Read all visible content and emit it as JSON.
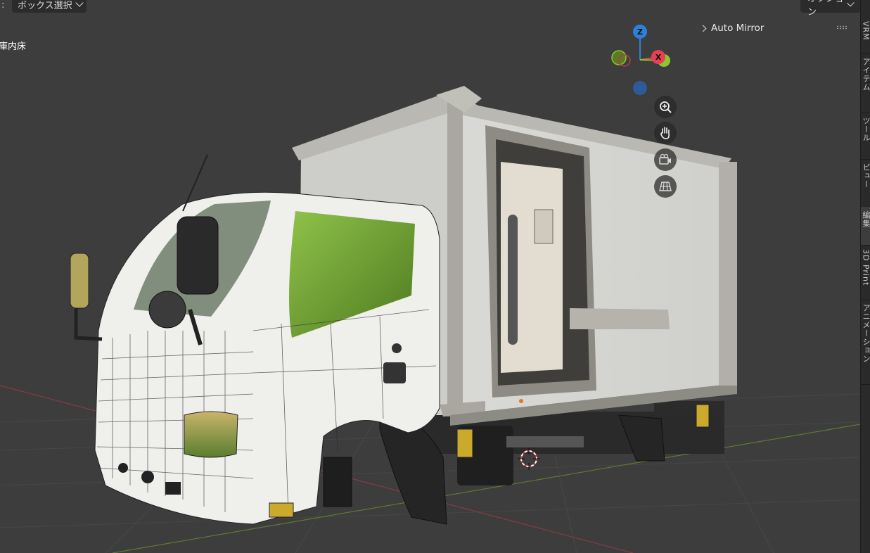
{
  "header": {
    "colon": ":",
    "select_mode": "ボックス選択",
    "options": "オプション"
  },
  "viewport": {
    "object_label": "庫内床",
    "auto_mirror": "Auto Mirror"
  },
  "gizmo": {
    "z": "Z",
    "x": "X"
  },
  "sidebar": {
    "tabs": [
      "VRM",
      "アイテム",
      "ツール",
      "ビュー",
      "編集",
      "3D Print",
      "アニメーション"
    ]
  },
  "colors": {
    "axis_x": "#e83e56",
    "axis_y": "#8bc72f",
    "axis_z": "#2e7fd8",
    "background": "#3d3d3d",
    "panel": "#2b2b2b"
  },
  "icons": {
    "zoom": "zoom-icon",
    "pan": "hand-icon",
    "camera": "camera-icon",
    "perspective": "grid-icon"
  }
}
